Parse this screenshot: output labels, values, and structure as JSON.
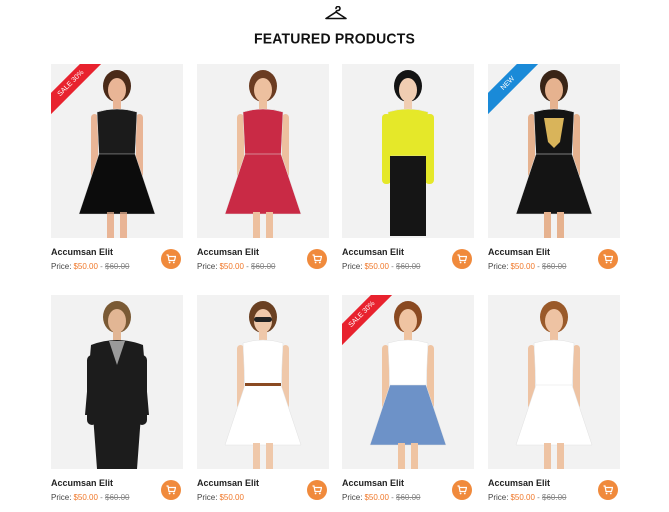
{
  "section": {
    "title": "FEATURED PRODUCTS",
    "icon": "hanger-icon"
  },
  "colors": {
    "accent": "#f08a3c",
    "sale_ribbon": "#e8222e",
    "new_ribbon": "#1a8ad8",
    "price": "#f0782a"
  },
  "products": [
    {
      "name": "Accumsan Elit",
      "price_label": "Price:",
      "price": "$50.00",
      "old_price": "$60.00",
      "ribbon": "SALE 30%",
      "ribbon_type": "sale",
      "image": "woman-black-sheer-dress"
    },
    {
      "name": "Accumsan Elit",
      "price_label": "Price:",
      "price": "$50.00",
      "old_price": "$60.00",
      "ribbon": "",
      "ribbon_type": "",
      "image": "woman-red-offshoulder-dress"
    },
    {
      "name": "Accumsan Elit",
      "price_label": "Price:",
      "price": "$50.00",
      "old_price": "$60.00",
      "ribbon": "",
      "ribbon_type": "",
      "image": "woman-yellow-sweater"
    },
    {
      "name": "Accumsan Elit",
      "price_label": "Price:",
      "price": "$50.00",
      "old_price": "$60.00",
      "ribbon": "NEW",
      "ribbon_type": "new",
      "image": "woman-black-gold-dress"
    },
    {
      "name": "Accumsan Elit",
      "price_label": "Price:",
      "price": "$50.00",
      "old_price": "$60.00",
      "ribbon": "",
      "ribbon_type": "",
      "image": "man-black-blazer"
    },
    {
      "name": "Accumsan Elit",
      "price_label": "Price:",
      "price": "$50.00",
      "old_price": "",
      "ribbon": "",
      "ribbon_type": "",
      "image": "woman-white-dress-sunglasses"
    },
    {
      "name": "Accumsan Elit",
      "price_label": "Price:",
      "price": "$50.00",
      "old_price": "$60.00",
      "ribbon": "SALE 30%",
      "ribbon_type": "sale",
      "image": "woman-blue-skirt"
    },
    {
      "name": "Accumsan Elit",
      "price_label": "Price:",
      "price": "$50.00",
      "old_price": "$60.00",
      "ribbon": "",
      "ribbon_type": "",
      "image": "woman-white-lace-dress"
    }
  ]
}
